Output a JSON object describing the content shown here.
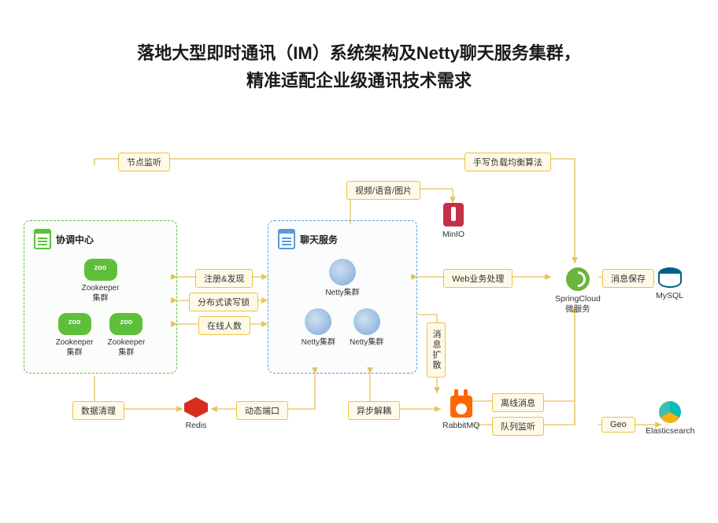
{
  "title": {
    "line1": "落地大型即时通讯（IM）系统架构及Netty聊天服务集群，",
    "line2": "精准适配企业级通讯技术需求"
  },
  "clusters": {
    "coord": {
      "title": "协调中心",
      "nodes": [
        "Zookeeper\n集群",
        "Zookeeper\n集群",
        "Zookeeper\n集群"
      ]
    },
    "chat": {
      "title": "聊天服务",
      "nodes": [
        "Netty集群",
        "Netty集群",
        "Netty集群"
      ]
    }
  },
  "tags": {
    "node_listen": "节点监听",
    "load_balance": "手写负载均衡算法",
    "media": "视频/语音/图片",
    "register": "注册&发现",
    "lock": "分布式读写锁",
    "online": "在线人数",
    "web_biz": "Web业务处理",
    "msg_persist": "消息保存",
    "msg_spread": "消息扩散",
    "data_clean": "数据清理",
    "dyn_port": "动态端口",
    "async": "异步解耦",
    "offline": "离线消息",
    "queue_listen": "队列监听",
    "geo": "Geo"
  },
  "tech": {
    "minio": "MinIO",
    "spring": "SpringCloud\n微服务",
    "mysql": "MySQL",
    "redis": "Redis",
    "rabbitmq": "RabbitMQ",
    "es": "Elasticsearch"
  }
}
